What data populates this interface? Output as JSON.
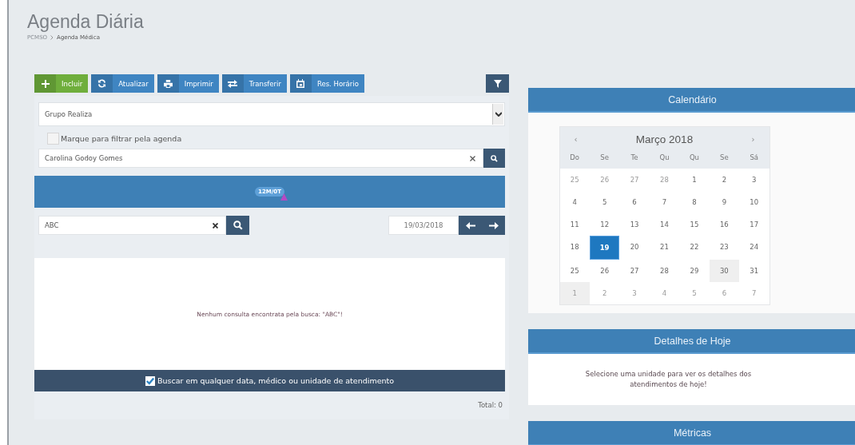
{
  "page": {
    "title": "Agenda Diária",
    "breadcrumb": [
      "PCMSO",
      "Agenda Médica"
    ]
  },
  "toolbar": [
    {
      "label": "Incluir",
      "kind": "plus",
      "color": "#6fae3c"
    },
    {
      "label": "Atualizar",
      "kind": "refresh",
      "color": "#3f85c2"
    },
    {
      "label": "Imprimir",
      "kind": "print",
      "color": "#3f85c2"
    },
    {
      "label": "Transferir",
      "kind": "transfer",
      "color": "#3f85c2"
    },
    {
      "label": "Res. Horário",
      "kind": "calendar",
      "color": "#3f85c2"
    }
  ],
  "group_select": {
    "value": "Grupo Realiza"
  },
  "filter_checkbox": {
    "label": "Marque para filtrar pela agenda",
    "checked": false
  },
  "doctor_field": {
    "value": "Carolina Godoy Gomes"
  },
  "schedule_bar": {
    "badge": "12M/0T"
  },
  "search_field": {
    "value": "ABC"
  },
  "date_field": {
    "value": "19/03/2018"
  },
  "results": {
    "message": "Nenhum consulta encontrata pela busca: \"ABC\"!"
  },
  "any_date_checkbox": {
    "label": "Buscar em qualquer data, médico ou unidade de atendimento",
    "checked": true
  },
  "total": "Total: 0",
  "calendar": {
    "title": "Calendário",
    "prev": "‹",
    "month": "Março 2018",
    "next": "›",
    "weekdays": [
      "Do",
      "Se",
      "Te",
      "Qu",
      "Qu",
      "Se",
      "Sá"
    ],
    "weeks": [
      [
        {
          "label": "25",
          "other_month": true,
          "selected": false,
          "shaded": false
        },
        {
          "label": "26",
          "other_month": true,
          "selected": false,
          "shaded": false
        },
        {
          "label": "27",
          "other_month": true,
          "selected": false,
          "shaded": false
        },
        {
          "label": "28",
          "other_month": true,
          "selected": false,
          "shaded": false
        },
        {
          "label": "1",
          "other_month": false,
          "selected": false,
          "shaded": false
        },
        {
          "label": "2",
          "other_month": false,
          "selected": false,
          "shaded": false
        },
        {
          "label": "3",
          "other_month": false,
          "selected": false,
          "shaded": false
        }
      ],
      [
        {
          "label": "4",
          "other_month": false,
          "selected": false,
          "shaded": false
        },
        {
          "label": "5",
          "other_month": false,
          "selected": false,
          "shaded": false
        },
        {
          "label": "6",
          "other_month": false,
          "selected": false,
          "shaded": false
        },
        {
          "label": "7",
          "other_month": false,
          "selected": false,
          "shaded": false
        },
        {
          "label": "8",
          "other_month": false,
          "selected": false,
          "shaded": false
        },
        {
          "label": "9",
          "other_month": false,
          "selected": false,
          "shaded": false
        },
        {
          "label": "10",
          "other_month": false,
          "selected": false,
          "shaded": false
        }
      ],
      [
        {
          "label": "11",
          "other_month": false,
          "selected": false,
          "shaded": false
        },
        {
          "label": "12",
          "other_month": false,
          "selected": false,
          "shaded": false
        },
        {
          "label": "13",
          "other_month": false,
          "selected": false,
          "shaded": false
        },
        {
          "label": "14",
          "other_month": false,
          "selected": false,
          "shaded": false
        },
        {
          "label": "15",
          "other_month": false,
          "selected": false,
          "shaded": false
        },
        {
          "label": "16",
          "other_month": false,
          "selected": false,
          "shaded": false
        },
        {
          "label": "17",
          "other_month": false,
          "selected": false,
          "shaded": false
        }
      ],
      [
        {
          "label": "18",
          "other_month": false,
          "selected": false,
          "shaded": false
        },
        {
          "label": "19",
          "other_month": false,
          "selected": true,
          "shaded": false
        },
        {
          "label": "20",
          "other_month": false,
          "selected": false,
          "shaded": false
        },
        {
          "label": "21",
          "other_month": false,
          "selected": false,
          "shaded": false
        },
        {
          "label": "22",
          "other_month": false,
          "selected": false,
          "shaded": false
        },
        {
          "label": "23",
          "other_month": false,
          "selected": false,
          "shaded": false
        },
        {
          "label": "24",
          "other_month": false,
          "selected": false,
          "shaded": false
        }
      ],
      [
        {
          "label": "25",
          "other_month": false,
          "selected": false,
          "shaded": false
        },
        {
          "label": "26",
          "other_month": false,
          "selected": false,
          "shaded": false
        },
        {
          "label": "27",
          "other_month": false,
          "selected": false,
          "shaded": false
        },
        {
          "label": "28",
          "other_month": false,
          "selected": false,
          "shaded": false
        },
        {
          "label": "29",
          "other_month": false,
          "selected": false,
          "shaded": false
        },
        {
          "label": "30",
          "other_month": false,
          "selected": false,
          "shaded": true
        },
        {
          "label": "31",
          "other_month": false,
          "selected": false,
          "shaded": false
        }
      ],
      [
        {
          "label": "1",
          "other_month": true,
          "selected": false,
          "shaded": true
        },
        {
          "label": "2",
          "other_month": true,
          "selected": false,
          "shaded": false
        },
        {
          "label": "3",
          "other_month": true,
          "selected": false,
          "shaded": false
        },
        {
          "label": "4",
          "other_month": true,
          "selected": false,
          "shaded": false
        },
        {
          "label": "5",
          "other_month": true,
          "selected": false,
          "shaded": false
        },
        {
          "label": "6",
          "other_month": true,
          "selected": false,
          "shaded": false
        },
        {
          "label": "7",
          "other_month": true,
          "selected": false,
          "shaded": false
        }
      ]
    ]
  },
  "today": {
    "title": "Detalhes de Hoje",
    "message": "Selecione uma unidade para ver os detalhes dos atendimentos de hoje!"
  },
  "metrics": {
    "title": "Métricas"
  }
}
